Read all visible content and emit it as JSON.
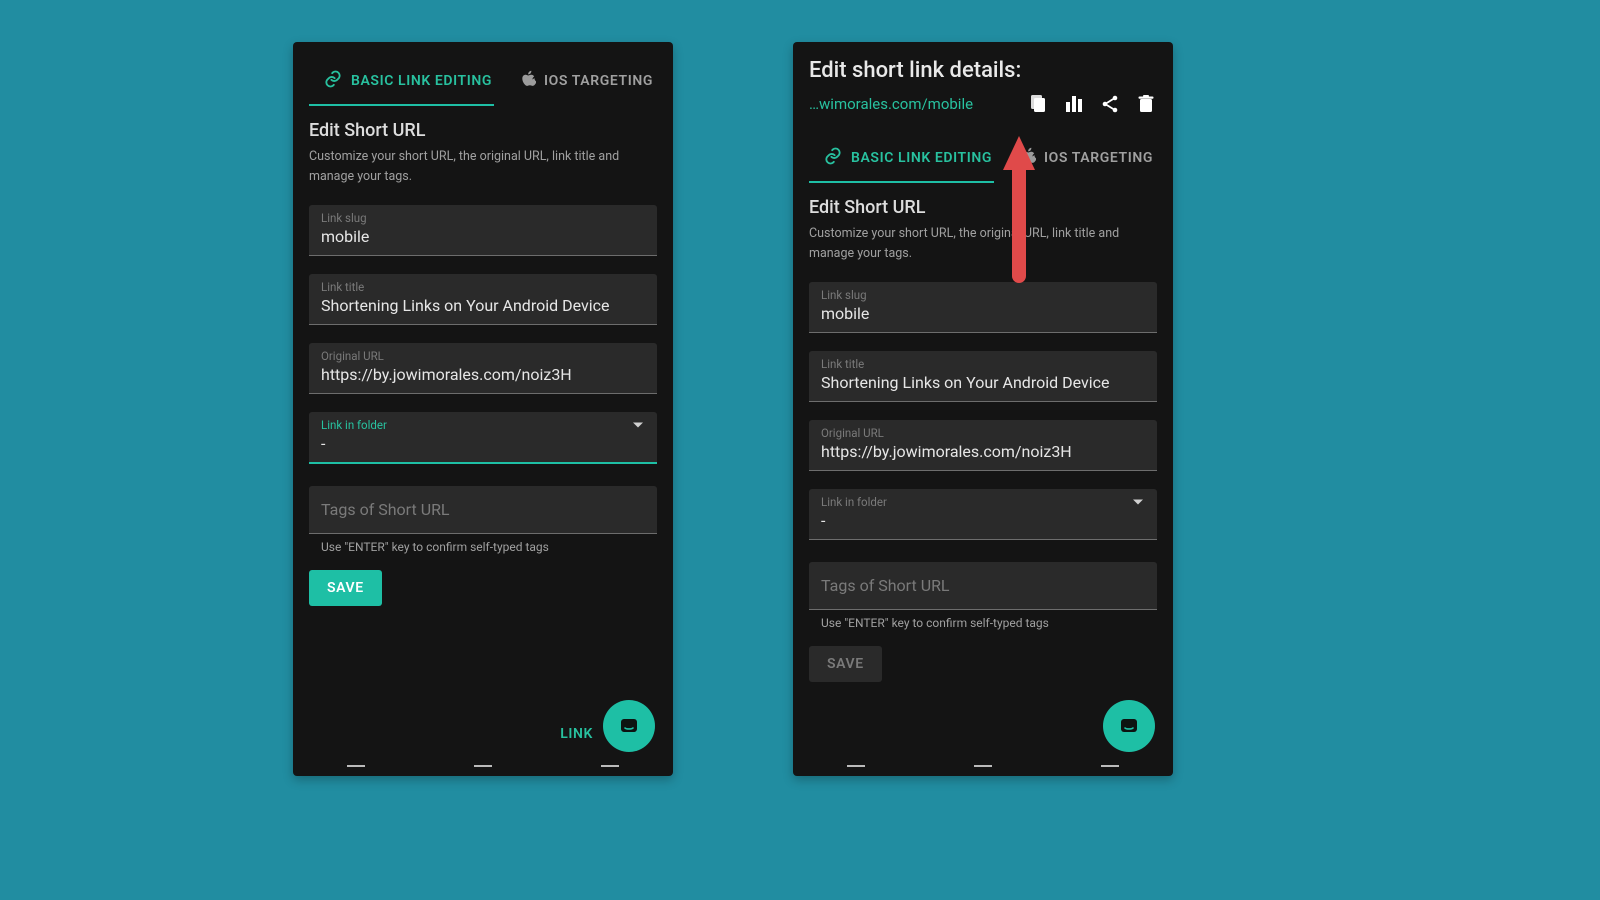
{
  "colors": {
    "accent": "#1EBFA5",
    "background": "#218DA1",
    "panel": "#141414",
    "arrow": "#E04A4A"
  },
  "tabs": {
    "basic": "BASIC LINK EDITING",
    "ios": "IOS TARGETING"
  },
  "form": {
    "section_title": "Edit Short URL",
    "section_desc": "Customize your short URL, the original URL, link title and manage your tags.",
    "slug_label": "Link slug",
    "slug_value": "mobile",
    "title_label": "Link title",
    "title_value": "Shortening Links on Your Android Device",
    "url_label": "Original URL",
    "url_value": "https://by.jowimorales.com/noiz3H",
    "folder_label": "Link in folder",
    "folder_value": "-",
    "tags_placeholder": "Tags of Short URL",
    "tags_hint": "Use \"ENTER\" key to confirm self-typed tags",
    "save_label": "SAVE",
    "bottom_link_label": "LINK"
  },
  "right_header": {
    "title": "Edit short link details:",
    "url_display": "…wimorales.com/mobile"
  }
}
